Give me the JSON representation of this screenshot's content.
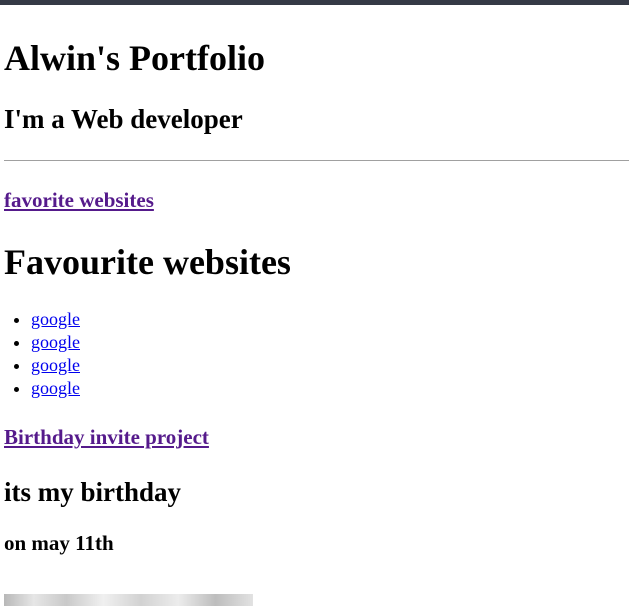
{
  "header": {
    "title": "Alwin's Portfolio",
    "subtitle": "I'm a Web developer"
  },
  "favorites": {
    "nav_link": "favorite websites",
    "heading": "Favourite websites",
    "links": [
      "google",
      "google",
      "google",
      "google"
    ]
  },
  "birthday": {
    "nav_link": "Birthday invite project",
    "heading": "its my birthday",
    "date": "on may 11th"
  },
  "colors": {
    "visited_link": "#551a8b",
    "link": "#0000ee",
    "top_bar": "#353a46"
  }
}
